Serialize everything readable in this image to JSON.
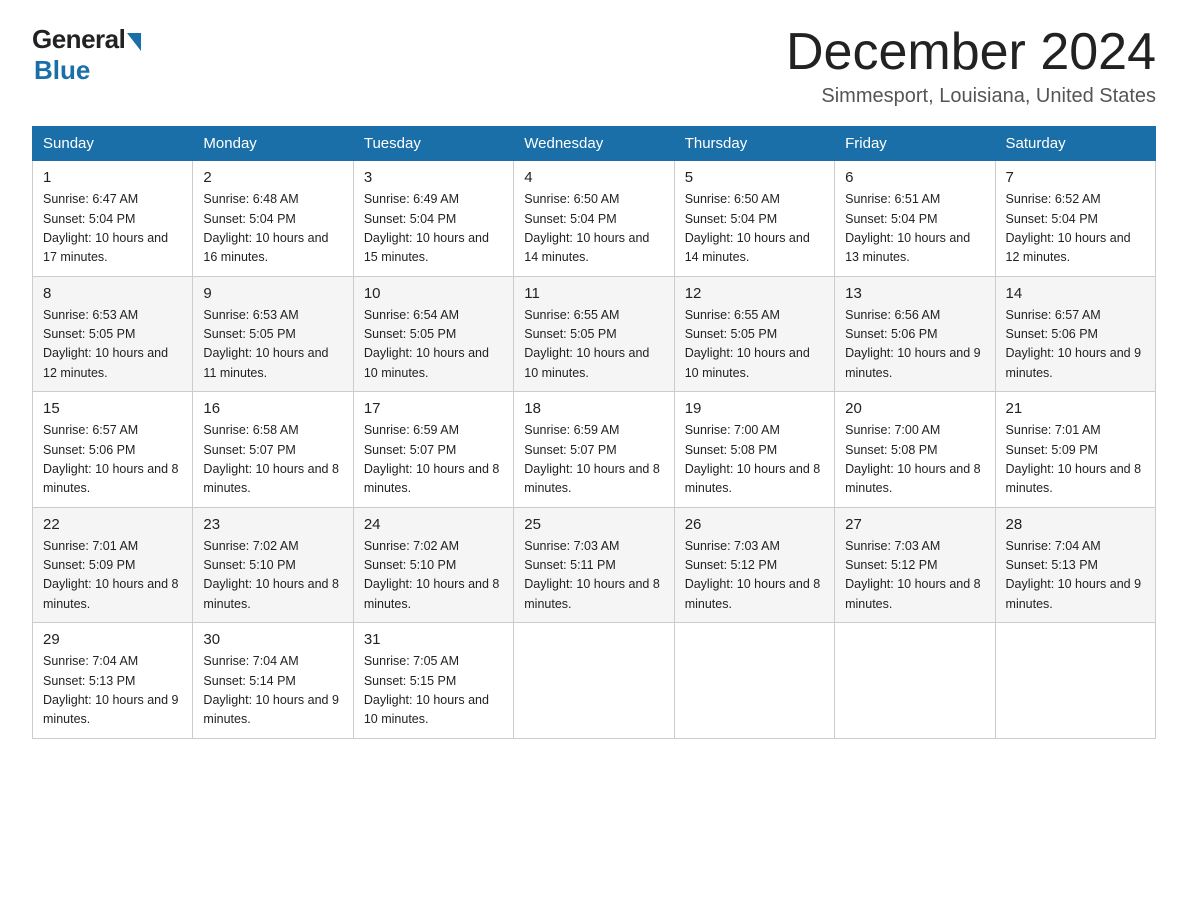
{
  "header": {
    "logo_general": "General",
    "logo_blue": "Blue",
    "month_title": "December 2024",
    "subtitle": "Simmesport, Louisiana, United States"
  },
  "days_of_week": [
    "Sunday",
    "Monday",
    "Tuesday",
    "Wednesday",
    "Thursday",
    "Friday",
    "Saturday"
  ],
  "weeks": [
    [
      {
        "day": "1",
        "sunrise": "6:47 AM",
        "sunset": "5:04 PM",
        "daylight": "10 hours and 17 minutes."
      },
      {
        "day": "2",
        "sunrise": "6:48 AM",
        "sunset": "5:04 PM",
        "daylight": "10 hours and 16 minutes."
      },
      {
        "day": "3",
        "sunrise": "6:49 AM",
        "sunset": "5:04 PM",
        "daylight": "10 hours and 15 minutes."
      },
      {
        "day": "4",
        "sunrise": "6:50 AM",
        "sunset": "5:04 PM",
        "daylight": "10 hours and 14 minutes."
      },
      {
        "day": "5",
        "sunrise": "6:50 AM",
        "sunset": "5:04 PM",
        "daylight": "10 hours and 14 minutes."
      },
      {
        "day": "6",
        "sunrise": "6:51 AM",
        "sunset": "5:04 PM",
        "daylight": "10 hours and 13 minutes."
      },
      {
        "day": "7",
        "sunrise": "6:52 AM",
        "sunset": "5:04 PM",
        "daylight": "10 hours and 12 minutes."
      }
    ],
    [
      {
        "day": "8",
        "sunrise": "6:53 AM",
        "sunset": "5:05 PM",
        "daylight": "10 hours and 12 minutes."
      },
      {
        "day": "9",
        "sunrise": "6:53 AM",
        "sunset": "5:05 PM",
        "daylight": "10 hours and 11 minutes."
      },
      {
        "day": "10",
        "sunrise": "6:54 AM",
        "sunset": "5:05 PM",
        "daylight": "10 hours and 10 minutes."
      },
      {
        "day": "11",
        "sunrise": "6:55 AM",
        "sunset": "5:05 PM",
        "daylight": "10 hours and 10 minutes."
      },
      {
        "day": "12",
        "sunrise": "6:55 AM",
        "sunset": "5:05 PM",
        "daylight": "10 hours and 10 minutes."
      },
      {
        "day": "13",
        "sunrise": "6:56 AM",
        "sunset": "5:06 PM",
        "daylight": "10 hours and 9 minutes."
      },
      {
        "day": "14",
        "sunrise": "6:57 AM",
        "sunset": "5:06 PM",
        "daylight": "10 hours and 9 minutes."
      }
    ],
    [
      {
        "day": "15",
        "sunrise": "6:57 AM",
        "sunset": "5:06 PM",
        "daylight": "10 hours and 8 minutes."
      },
      {
        "day": "16",
        "sunrise": "6:58 AM",
        "sunset": "5:07 PM",
        "daylight": "10 hours and 8 minutes."
      },
      {
        "day": "17",
        "sunrise": "6:59 AM",
        "sunset": "5:07 PM",
        "daylight": "10 hours and 8 minutes."
      },
      {
        "day": "18",
        "sunrise": "6:59 AM",
        "sunset": "5:07 PM",
        "daylight": "10 hours and 8 minutes."
      },
      {
        "day": "19",
        "sunrise": "7:00 AM",
        "sunset": "5:08 PM",
        "daylight": "10 hours and 8 minutes."
      },
      {
        "day": "20",
        "sunrise": "7:00 AM",
        "sunset": "5:08 PM",
        "daylight": "10 hours and 8 minutes."
      },
      {
        "day": "21",
        "sunrise": "7:01 AM",
        "sunset": "5:09 PM",
        "daylight": "10 hours and 8 minutes."
      }
    ],
    [
      {
        "day": "22",
        "sunrise": "7:01 AM",
        "sunset": "5:09 PM",
        "daylight": "10 hours and 8 minutes."
      },
      {
        "day": "23",
        "sunrise": "7:02 AM",
        "sunset": "5:10 PM",
        "daylight": "10 hours and 8 minutes."
      },
      {
        "day": "24",
        "sunrise": "7:02 AM",
        "sunset": "5:10 PM",
        "daylight": "10 hours and 8 minutes."
      },
      {
        "day": "25",
        "sunrise": "7:03 AM",
        "sunset": "5:11 PM",
        "daylight": "10 hours and 8 minutes."
      },
      {
        "day": "26",
        "sunrise": "7:03 AM",
        "sunset": "5:12 PM",
        "daylight": "10 hours and 8 minutes."
      },
      {
        "day": "27",
        "sunrise": "7:03 AM",
        "sunset": "5:12 PM",
        "daylight": "10 hours and 8 minutes."
      },
      {
        "day": "28",
        "sunrise": "7:04 AM",
        "sunset": "5:13 PM",
        "daylight": "10 hours and 9 minutes."
      }
    ],
    [
      {
        "day": "29",
        "sunrise": "7:04 AM",
        "sunset": "5:13 PM",
        "daylight": "10 hours and 9 minutes."
      },
      {
        "day": "30",
        "sunrise": "7:04 AM",
        "sunset": "5:14 PM",
        "daylight": "10 hours and 9 minutes."
      },
      {
        "day": "31",
        "sunrise": "7:05 AM",
        "sunset": "5:15 PM",
        "daylight": "10 hours and 10 minutes."
      },
      null,
      null,
      null,
      null
    ]
  ],
  "labels": {
    "sunrise_prefix": "Sunrise: ",
    "sunset_prefix": "Sunset: ",
    "daylight_prefix": "Daylight: "
  }
}
